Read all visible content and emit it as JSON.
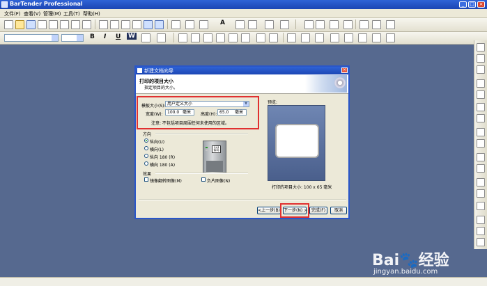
{
  "window": {
    "title": "BarTender Professional",
    "controls": {
      "minimize": "_",
      "maximize": "□",
      "close": "×"
    }
  },
  "menu": [
    "文件(F)",
    "查看(V)",
    "管理(M)",
    "工具(T)",
    "帮助(H)"
  ],
  "toolbar": {
    "bold": "B",
    "italic": "I",
    "underline": "U",
    "word_wrap": "W",
    "text_tool": "A"
  },
  "dialog": {
    "title": "新建文档向导",
    "close": "×",
    "header_title": "打印的项目大小",
    "header_subtitle": "指定项目的大小。",
    "template_size_label": "模板大小(S):",
    "template_size_value": "用户定义大小",
    "width_label": "宽度(W):",
    "width_value": "100.0",
    "width_unit": "毫米",
    "height_label": "高度(H):",
    "height_value": "65.0",
    "height_unit": "毫米",
    "note": "注意: 不包括项目周围任何未使用的区域。",
    "preview_label": "预览:",
    "preview_caption": "打印的项目大小: 100 x 65 毫米",
    "orientation_group": "方向",
    "orientations": [
      {
        "label": "纵向(U)",
        "selected": true
      },
      {
        "label": "横向(L)",
        "selected": false
      },
      {
        "label": "纵向 180 (R)",
        "selected": false
      },
      {
        "label": "横向 180 (A)",
        "selected": false
      }
    ],
    "effects_group": "效果",
    "mirror_label": "镜像翻转图像(M)",
    "negative_label": "负片图像(N)",
    "printer_slot_text": "123\n条码",
    "buttons": {
      "back": "<上一步(B)",
      "next": "下一步(N) >",
      "finish": "完成(F)",
      "cancel": "取消"
    }
  },
  "watermark": {
    "logo": "Bai",
    "logo_suffix": "经验",
    "url": "jingyan.baidu.com"
  },
  "colors": {
    "workspace": "#56698f",
    "titlebar": "#1c46b4",
    "highlight_box": "#e03030"
  }
}
